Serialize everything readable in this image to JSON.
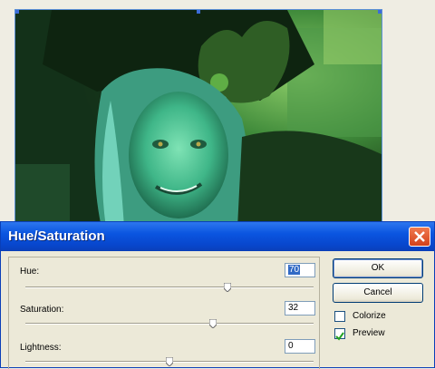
{
  "dialog": {
    "title": "Hue/Saturation",
    "hue": {
      "label": "Hue:",
      "value": "70",
      "slider_position": 0.7
    },
    "saturation": {
      "label": "Saturation:",
      "value": "32",
      "slider_position": 0.65
    },
    "lightness": {
      "label": "Lightness:",
      "value": "0",
      "slider_position": 0.5
    },
    "ok_label": "OK",
    "cancel_label": "Cancel",
    "colorize": {
      "label": "Colorize",
      "checked": false
    },
    "preview": {
      "label": "Preview",
      "checked": true
    }
  },
  "colors": {
    "title_bar": "#0a55e0",
    "dialog_bg": "#ece9d8",
    "close_button": "#d4411a",
    "image_tint": "#2e8a4e"
  }
}
